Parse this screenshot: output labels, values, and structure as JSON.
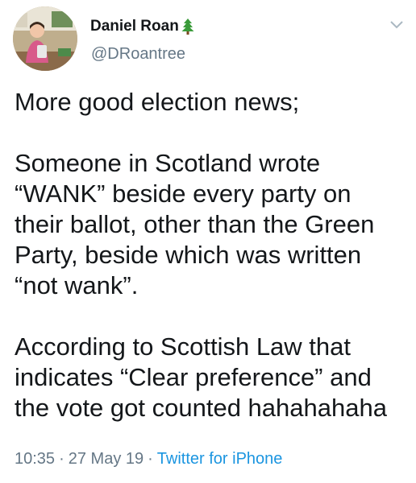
{
  "author": {
    "display_name": "Daniel Roan",
    "name_emoji_icon": "evergreen-tree-icon",
    "handle": "@DRoantree",
    "avatar_icon": "profile-photo"
  },
  "tweet": {
    "lines": [
      "More good election news;",
      "",
      "Someone in Scotland wrote",
      "“WANK” beside every party on",
      "their ballot, other than the Green",
      "Party, beside which was written",
      "“not wank”.",
      "",
      "According to Scottish Law that",
      "indicates “Clear preference” and",
      "the vote got counted hahahahaha"
    ]
  },
  "meta": {
    "time": "10:35",
    "separator": "·",
    "date": "27 May 19",
    "source": "Twitter for iPhone"
  },
  "menu": {
    "icon": "chevron-down-icon"
  },
  "colors": {
    "text": "#14171a",
    "secondary": "#657786",
    "link": "#1b95e0",
    "chevron": "#aab8c2"
  }
}
